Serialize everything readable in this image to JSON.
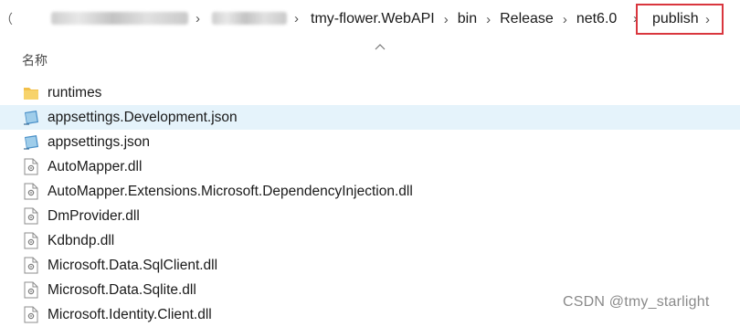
{
  "address_bar": {
    "left_fragment": "（",
    "segments": [
      "tmy-flower.WebAPI",
      "bin",
      "Release",
      "net6.0"
    ],
    "current": "publish"
  },
  "columns": {
    "name_header": "名称"
  },
  "files": [
    {
      "name": "runtimes",
      "icon": "folder-icon"
    },
    {
      "name": "appsettings.Development.json",
      "icon": "json-file-icon",
      "selected": true
    },
    {
      "name": "appsettings.json",
      "icon": "json-file-icon"
    },
    {
      "name": "AutoMapper.dll",
      "icon": "dll-file-icon"
    },
    {
      "name": "AutoMapper.Extensions.Microsoft.DependencyInjection.dll",
      "icon": "dll-file-icon"
    },
    {
      "name": "DmProvider.dll",
      "icon": "dll-file-icon"
    },
    {
      "name": "Kdbndp.dll",
      "icon": "dll-file-icon"
    },
    {
      "name": "Microsoft.Data.SqlClient.dll",
      "icon": "dll-file-icon"
    },
    {
      "name": "Microsoft.Data.Sqlite.dll",
      "icon": "dll-file-icon"
    },
    {
      "name": "Microsoft.Identity.Client.dll",
      "icon": "dll-file-icon"
    }
  ],
  "watermark": "CSDN @tmy_starlight",
  "colors": {
    "selection": "#e5f3fb",
    "highlight_box": "#d9363e",
    "folder": "#f2c04a"
  }
}
